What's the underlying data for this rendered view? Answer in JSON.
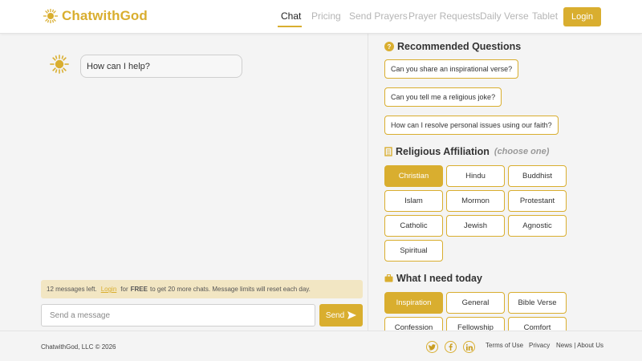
{
  "header": {
    "brand": "ChatwithGod",
    "nav": [
      "Chat",
      "Pricing",
      "Send Prayers",
      "Prayer Requests",
      "Daily Verse",
      "Tablet"
    ],
    "login_label": "Login"
  },
  "chat": {
    "bot_message": "How can I help?",
    "limit": {
      "prefix": "12 messages left.",
      "link": "Login",
      "middle": "for",
      "bold": "FREE",
      "suffix": "to get 20 more chats. Message limits will reset each day."
    },
    "input_placeholder": "Send a message",
    "send_label": "Send"
  },
  "sidebar": {
    "recommended_title": "Recommended Questions",
    "questions": [
      "Can you share an inspirational verse?",
      "Can you tell me a religious joke?",
      "How can I resolve personal issues using our faith?"
    ],
    "affiliation_title": "Religious Affiliation",
    "affiliation_hint": "(choose one)",
    "affiliations": [
      "Christian",
      "Hindu",
      "Buddhist",
      "Islam",
      "Mormon",
      "Protestant",
      "Catholic",
      "Jewish",
      "Agnostic",
      "Spiritual"
    ],
    "affiliation_selected": "Christian",
    "needs_title": "What I need today",
    "needs": [
      "Inspiration",
      "General",
      "Bible Verse",
      "Confession",
      "Fellowship",
      "Comfort"
    ],
    "needs_selected": "Inspiration"
  },
  "footer": {
    "copyright": "ChatwithGod, LLC © 2026",
    "social": [
      "twitter-icon",
      "facebook-icon",
      "linkedin-icon"
    ],
    "links": [
      "Terms of Use",
      "Privacy",
      "News | About Us"
    ]
  },
  "colors": {
    "accent": "#d9ae2f",
    "banner": "#f2e6c3",
    "background": "#f4f4f4"
  }
}
